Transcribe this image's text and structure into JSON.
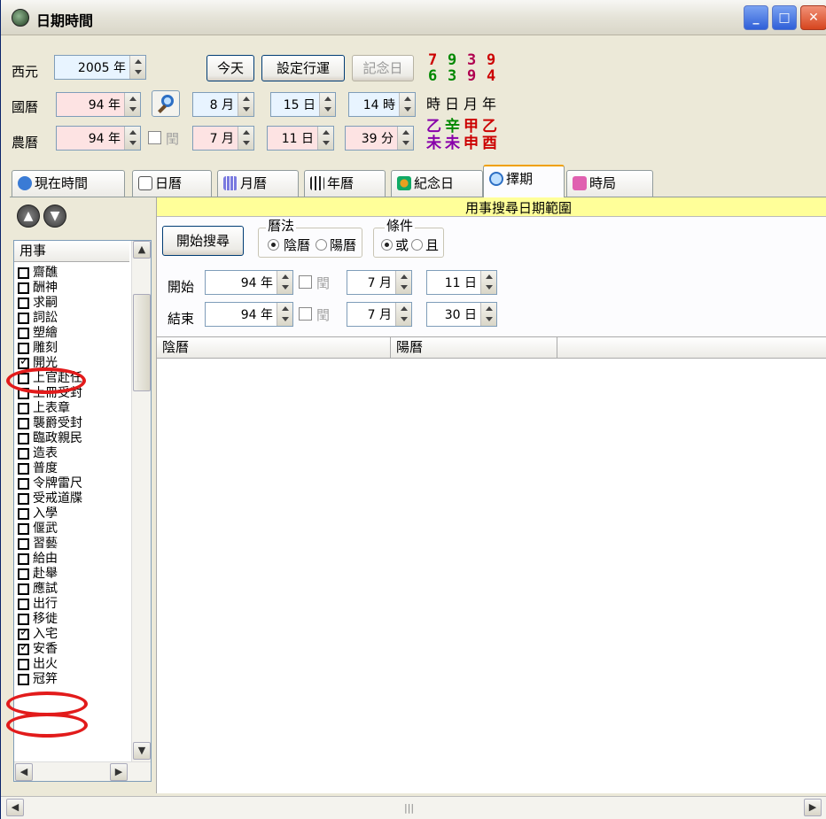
{
  "window": {
    "title": "日期時間"
  },
  "top": {
    "western": {
      "label": "西元",
      "value": "2005 年"
    },
    "roc": {
      "label": "國曆",
      "year": "94 年",
      "month": "8 月",
      "day": "15 日",
      "hour": "14 時"
    },
    "lunar": {
      "label": "農曆",
      "year": "94 年",
      "leap_label": "閏",
      "month": "7 月",
      "day": "11 日",
      "minute": "39 分"
    },
    "buttons": {
      "today": "今天",
      "set_fortune": "設定行運",
      "memorial": "記念日"
    },
    "number_grid": {
      "row1": [
        "7",
        "9",
        "3",
        "9"
      ],
      "row2": [
        "6",
        "3",
        "9",
        "4"
      ]
    },
    "pillar_labels": [
      "時",
      "日",
      "月",
      "年"
    ],
    "ganzhi_stems": [
      "乙",
      "辛",
      "甲",
      "乙"
    ],
    "ganzhi_branches": [
      "未",
      "未",
      "申",
      "酉"
    ],
    "colors": {
      "c1": "#cc0000",
      "c2": "#008800",
      "c3": "#b00050",
      "c4": "#cc0000",
      "purple": "#8800aa"
    }
  },
  "tabs": [
    "現在時間",
    "日曆",
    "月曆",
    "年曆",
    "紀念日",
    "擇期",
    "時局"
  ],
  "left": {
    "header": "用事",
    "items": [
      {
        "label": "齋醮",
        "checked": false
      },
      {
        "label": "酬神",
        "checked": false
      },
      {
        "label": "求嗣",
        "checked": false
      },
      {
        "label": "詞訟",
        "checked": false
      },
      {
        "label": "塑繪",
        "checked": false
      },
      {
        "label": "雕刻",
        "checked": false
      },
      {
        "label": "開光",
        "checked": true
      },
      {
        "label": "上官赴任",
        "checked": false
      },
      {
        "label": "上冊受封",
        "checked": false
      },
      {
        "label": "上表章",
        "checked": false
      },
      {
        "label": "襲爵受封",
        "checked": false
      },
      {
        "label": "臨政親民",
        "checked": false
      },
      {
        "label": "造表",
        "checked": false
      },
      {
        "label": "普度",
        "checked": false
      },
      {
        "label": "令牌雷尺",
        "checked": false
      },
      {
        "label": "受戒道牒",
        "checked": false
      },
      {
        "label": "入學",
        "checked": false
      },
      {
        "label": "偃武",
        "checked": false
      },
      {
        "label": "習藝",
        "checked": false
      },
      {
        "label": "給由",
        "checked": false
      },
      {
        "label": "赴舉",
        "checked": false
      },
      {
        "label": "應試",
        "checked": false
      },
      {
        "label": "出行",
        "checked": false
      },
      {
        "label": "移徙",
        "checked": false
      },
      {
        "label": "入宅",
        "checked": true
      },
      {
        "label": "安香",
        "checked": true
      },
      {
        "label": "出火",
        "checked": false
      },
      {
        "label": "冠笄",
        "checked": false
      }
    ]
  },
  "right": {
    "banner": "用事搜尋日期範圍",
    "search_button": "開始搜尋",
    "calendar_group": {
      "title": "曆法",
      "opt1": "陰曆",
      "opt2": "陽曆"
    },
    "condition_group": {
      "title": "條件",
      "opt1": "或",
      "opt2": "且"
    },
    "start": {
      "label": "開始",
      "year": "94 年",
      "leap": "閏",
      "month": "7 月",
      "day": "11 日"
    },
    "end": {
      "label": "結束",
      "year": "94 年",
      "leap": "閏",
      "month": "7 月",
      "day": "30 日"
    },
    "columns": [
      "陰曆",
      "陽曆"
    ]
  }
}
